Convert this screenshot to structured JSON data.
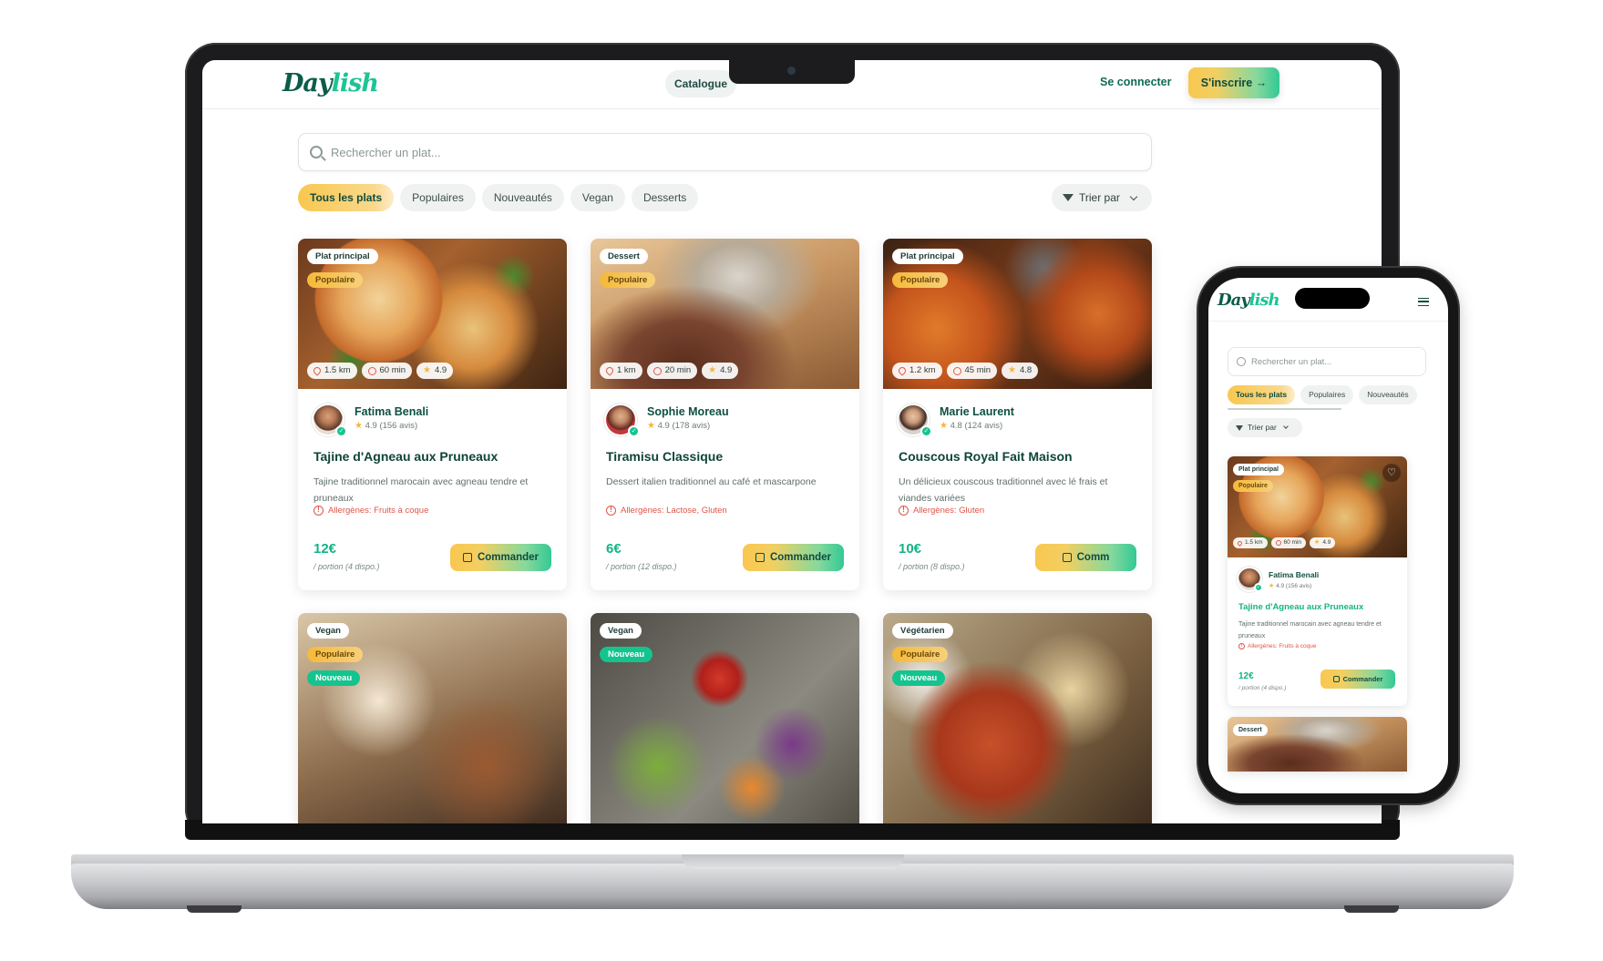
{
  "brand": {
    "logo_main": "Day",
    "logo_accent": "lish"
  },
  "nav": {
    "catalogue": "Catalogue",
    "login": "Se connecter",
    "signup": "S'inscrire",
    "signup_arrow": "→"
  },
  "search": {
    "placeholder": "Rechercher un plat..."
  },
  "filters": [
    "Tous les plats",
    "Populaires",
    "Nouveautés",
    "Vegan",
    "Desserts"
  ],
  "sort_label": "Trier par",
  "cards": [
    {
      "category": "Plat principal",
      "badges": [
        "Populaire"
      ],
      "distance": "1.5 km",
      "time": "60 min",
      "rating": "4.9",
      "chef": "Fatima Benali",
      "chef_rating": "4.9 (156 avis)",
      "title": "Tajine d'Agneau aux Pruneaux",
      "description": "Tajine traditionnel marocain avec agneau tendre et pruneaux",
      "allergens": "Allergènes: Fruits à coque",
      "price": "12€",
      "portion": "/ portion (4 dispo.)",
      "order": "Commander"
    },
    {
      "category": "Dessert",
      "badges": [
        "Populaire"
      ],
      "distance": "1 km",
      "time": "20 min",
      "rating": "4.9",
      "chef": "Sophie Moreau",
      "chef_rating": "4.9 (178 avis)",
      "title": "Tiramisu Classique",
      "description": "Dessert italien traditionnel au café et mascarpone",
      "allergens": "Allergènes: Lactose, Gluten",
      "price": "6€",
      "portion": "/ portion (12 dispo.)",
      "order": "Commander"
    },
    {
      "category": "Plat principal",
      "badges": [
        "Populaire"
      ],
      "distance": "1.2 km",
      "time": "45 min",
      "rating": "4.8",
      "chef": "Marie Laurent",
      "chef_rating": "4.8 (124 avis)",
      "title": "Couscous Royal Fait Maison",
      "description": "Un délicieux couscous traditionnel avec lé frais et viandes variées",
      "allergens": "Allergènes: Gluten",
      "price": "10€",
      "portion": "/ portion (8 dispo.)",
      "order": "Comm"
    }
  ],
  "row2": [
    {
      "category": "Vegan",
      "badge1": "Populaire",
      "badge2": "Nouveau"
    },
    {
      "category": "Vegan",
      "badge1": "Nouveau"
    },
    {
      "category": "Végétarien",
      "badge1": "Populaire",
      "badge2": "Nouveau"
    }
  ],
  "mobile": {
    "search_placeholder": "Rechercher un plat...",
    "filters": [
      "Tous les plats",
      "Populaires",
      "Nouveautés"
    ],
    "sort_label": "Trier par",
    "card": {
      "category": "Plat principal",
      "badge": "Populaire",
      "distance": "1.5 km",
      "time": "60 min",
      "rating": "4.9",
      "chef": "Fatima Benali",
      "chef_rating": "4.9 (156 avis)",
      "title": "Tajine d'Agneau aux Pruneaux",
      "description": "Tajine traditionnel marocain avec agneau tendre et pruneaux",
      "allergens": "Allergènes: Fruits à coque",
      "price": "12€",
      "portion": "/ portion (4 dispo.)",
      "order": "Commander"
    },
    "next_category": "Dessert"
  },
  "colors": {
    "brand_dark": "#0c5c49",
    "brand_accent": "#1dc495",
    "price": "#14b386",
    "allergen": "#e0554a"
  }
}
